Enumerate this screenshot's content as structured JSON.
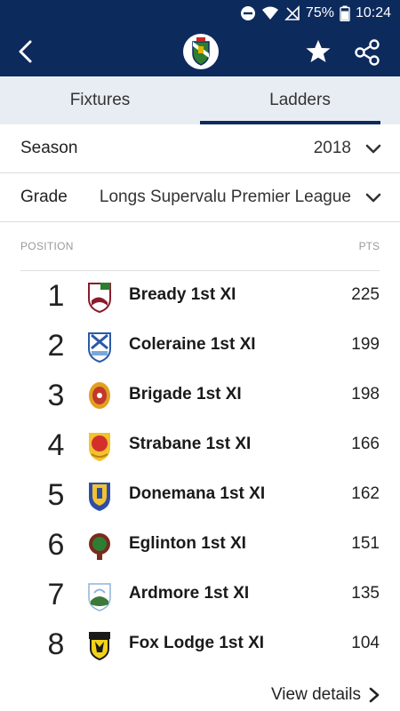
{
  "status_bar": {
    "battery": "75%",
    "time": "10:24"
  },
  "app_bar": {
    "back_icon": "back-arrow-icon",
    "logo": "club-crest",
    "favourite_icon": "star-icon",
    "share_icon": "share-icon"
  },
  "tabs": [
    {
      "label": "Fixtures",
      "active": false
    },
    {
      "label": "Ladders",
      "active": true
    }
  ],
  "filters": {
    "season": {
      "label": "Season",
      "value": "2018"
    },
    "grade": {
      "label": "Grade",
      "value": "Longs Supervalu Premier League"
    }
  },
  "ladder": {
    "header_position": "POSITION",
    "header_points": "PTS",
    "rows": [
      {
        "position": "1",
        "team": "Bready 1st XI",
        "pts": "225",
        "crest_color": "#8a1c2b"
      },
      {
        "position": "2",
        "team": "Coleraine 1st XI",
        "pts": "199",
        "crest_color": "#2a5aa8"
      },
      {
        "position": "3",
        "team": "Brigade 1st XI",
        "pts": "198",
        "crest_color": "#c0392b"
      },
      {
        "position": "4",
        "team": "Strabane 1st XI",
        "pts": "166",
        "crest_color": "#d4302b"
      },
      {
        "position": "5",
        "team": "Donemana 1st XI",
        "pts": "162",
        "crest_color": "#2e4ea3"
      },
      {
        "position": "6",
        "team": "Eglinton 1st XI",
        "pts": "151",
        "crest_color": "#7a2a1e"
      },
      {
        "position": "7",
        "team": "Ardmore 1st XI",
        "pts": "135",
        "crest_color": "#3a7a3a"
      },
      {
        "position": "8",
        "team": "Fox Lodge 1st XI",
        "pts": "104",
        "crest_color": "#d4b11a"
      }
    ]
  },
  "footer": {
    "view_details": "View details"
  },
  "colors": {
    "primary": "#0d2a5c",
    "tab_background": "#e8edf3"
  }
}
